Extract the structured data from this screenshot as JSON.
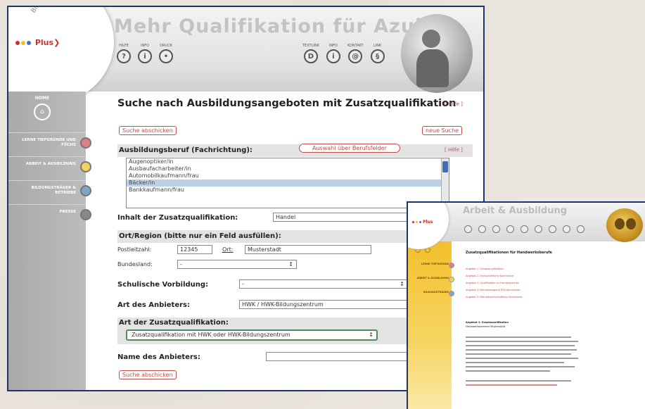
{
  "window_main": {
    "banner_title": "Mehr Qualifikation für Azubis",
    "logo": {
      "brand": "Plus",
      "sub": "Bildungsatlas"
    },
    "top_icons_left": [
      {
        "label": "HILFE",
        "glyph": "?"
      },
      {
        "label": "INFO",
        "glyph": "i"
      },
      {
        "label": "DRUCK",
        "glyph": "•"
      }
    ],
    "top_icons_right": [
      {
        "label": "TEXTLINK",
        "glyph": "D"
      },
      {
        "label": "INFO",
        "glyph": "i"
      },
      {
        "label": "KONTAKT",
        "glyph": "@"
      },
      {
        "label": "LINK",
        "glyph": "§"
      }
    ],
    "sidebar": {
      "home_label": "HOME",
      "items": [
        {
          "label": "LERNE TIEFGRÜNDE UND FÜCHS",
          "color": "#d98186"
        },
        {
          "label": "ARBEIT & AUSBILDUNG",
          "color": "#f0d35c"
        },
        {
          "label": "BILDUNGSTRÄGER & BETRIEBE",
          "color": "#7aa6c9"
        },
        {
          "label": "PRESSE",
          "color": "#888888"
        }
      ]
    },
    "page_title": "Suche nach Ausbildungsangeboten mit Zusatzqualifikation",
    "help_label": "[ Hilfe ]",
    "btn_search_top": "Suche abschicken",
    "btn_new_search": "neue Suche",
    "section_beruf": "Ausbildungsberuf (Fachrichtung):",
    "btn_berufsfelder": "Auswahl über Berufsfelder",
    "beruf_list": [
      "Augenoptiker/in",
      "Ausbaufacharbeiter/in",
      "Automobilkaufmann/frau",
      "Bäcker/in",
      "Bankkaufmann/frau"
    ],
    "beruf_selected": "Bäcker/in",
    "label_inhalt": "Inhalt der Zusatzqualifikation:",
    "value_inhalt": "Handel",
    "section_ort": "Ort/Region (bitte nur ein Feld ausfüllen):",
    "label_plz": "Postleitzahl:",
    "value_plz": "12345",
    "label_ort": "Ort:",
    "value_ort": "Musterstadt",
    "label_bundesland": "Bundesland:",
    "value_bundesland": "-",
    "label_vorbildung": "Schulische Vorbildung:",
    "value_vorbildung": "-",
    "label_anbieter": "Art des Anbieters:",
    "value_anbieter": "HWK / HWK-Bildungszentrum",
    "label_zq": "Art der Zusatzqualifikation:",
    "value_zq": "Zusatzqualifikation mit HWK oder HWK-Bildungszentrum",
    "label_name": "Name des Anbieters:",
    "btn_search_bottom": "Suche abschicken"
  },
  "window_result": {
    "banner_title": "Arbeit & Ausbildung",
    "logo_brand": "Plus",
    "heading": "Zusatzqualifikationen für Handwerksberufe",
    "links": [
      "Angebot 1: Zusatzqualifikation",
      "Angebot 2: Fachspezifische Kenntnisse",
      "Angebot 3: Qualifikation im Fremdsprachen",
      "Angebot 4: Berufsbezogene EDV-Kenntnisse",
      "Angebot 5: Betriebswirtschaftliche Kenntnisse"
    ],
    "detail_heading": "Angebot 1: Zusatzqualifikation",
    "detail_sub": "Handwerkskammer Musterstadt"
  }
}
